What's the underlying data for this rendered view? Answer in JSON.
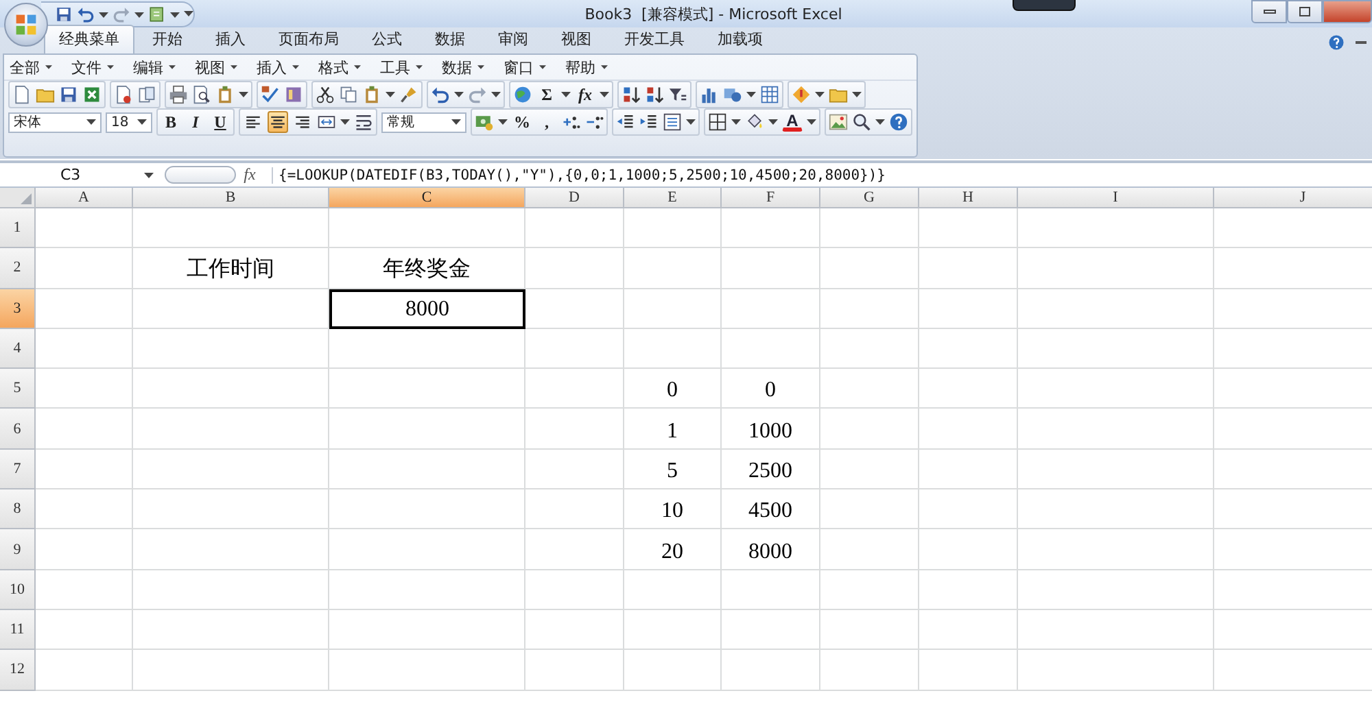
{
  "window": {
    "title": "Book3  [兼容模式] - Microsoft Excel"
  },
  "ribbon_tabs": [
    {
      "label": "经典菜单",
      "selected": true
    },
    {
      "label": "开始",
      "selected": false
    },
    {
      "label": "插入",
      "selected": false
    },
    {
      "label": "页面布局",
      "selected": false
    },
    {
      "label": "公式",
      "selected": false
    },
    {
      "label": "数据",
      "selected": false
    },
    {
      "label": "审阅",
      "selected": false
    },
    {
      "label": "视图",
      "selected": false
    },
    {
      "label": "开发工具",
      "selected": false
    },
    {
      "label": "加载项",
      "selected": false
    }
  ],
  "classic_menus": [
    "全部",
    "文件",
    "编辑",
    "视图",
    "插入",
    "格式",
    "工具",
    "数据",
    "窗口",
    "帮助"
  ],
  "toolbar": {
    "sum_label": "Σ",
    "fx_label": "fx",
    "font_name": "宋体",
    "font_size": "18",
    "bold_label": "B",
    "italic_label": "I",
    "underline_label": "U",
    "align_buttons": [
      {
        "selected": false
      },
      {
        "selected": true
      },
      {
        "selected": false
      }
    ],
    "number_format": "常规",
    "percent_label": "%",
    "comma_label": ",",
    "font_color_label": "A"
  },
  "formula_bar": {
    "name_box": "C3",
    "fx_label": "fx",
    "formula": "{=LOOKUP(DATEDIF(B3,TODAY(),\"Y\"),{0,0;1,1000;5,2500;10,4500;20,8000})}"
  },
  "columns": [
    {
      "label": "A",
      "selected": false
    },
    {
      "label": "B",
      "selected": false
    },
    {
      "label": "C",
      "selected": true
    },
    {
      "label": "D",
      "selected": false
    },
    {
      "label": "E",
      "selected": false
    },
    {
      "label": "F",
      "selected": false
    },
    {
      "label": "G",
      "selected": false
    },
    {
      "label": "H",
      "selected": false
    },
    {
      "label": "I",
      "selected": false
    },
    {
      "label": "J",
      "selected": false
    }
  ],
  "rows": [
    {
      "number": "1",
      "selected": false,
      "cells": {}
    },
    {
      "number": "2",
      "selected": false,
      "cells": {
        "B": {
          "text": "工作时间",
          "selected": false
        },
        "C": {
          "text": "年终奖金",
          "selected": false
        }
      }
    },
    {
      "number": "3",
      "selected": true,
      "cells": {
        "C": {
          "text": "8000",
          "selected": true
        }
      }
    },
    {
      "number": "4",
      "selected": false,
      "cells": {}
    },
    {
      "number": "5",
      "selected": false,
      "cells": {
        "E": {
          "text": "0",
          "selected": false
        },
        "F": {
          "text": "0",
          "selected": false
        }
      }
    },
    {
      "number": "6",
      "selected": false,
      "cells": {
        "E": {
          "text": "1",
          "selected": false
        },
        "F": {
          "text": "1000",
          "selected": false
        }
      }
    },
    {
      "number": "7",
      "selected": false,
      "cells": {
        "E": {
          "text": "5",
          "selected": false
        },
        "F": {
          "text": "2500",
          "selected": false
        }
      }
    },
    {
      "number": "8",
      "selected": false,
      "cells": {
        "E": {
          "text": "10",
          "selected": false
        },
        "F": {
          "text": "4500",
          "selected": false
        }
      }
    },
    {
      "number": "9",
      "selected": false,
      "cells": {
        "E": {
          "text": "20",
          "selected": false
        },
        "F": {
          "text": "8000",
          "selected": false
        }
      }
    },
    {
      "number": "10",
      "selected": false,
      "cells": {}
    },
    {
      "number": "11",
      "selected": false,
      "cells": {}
    },
    {
      "number": "12",
      "selected": false,
      "cells": {}
    }
  ]
}
